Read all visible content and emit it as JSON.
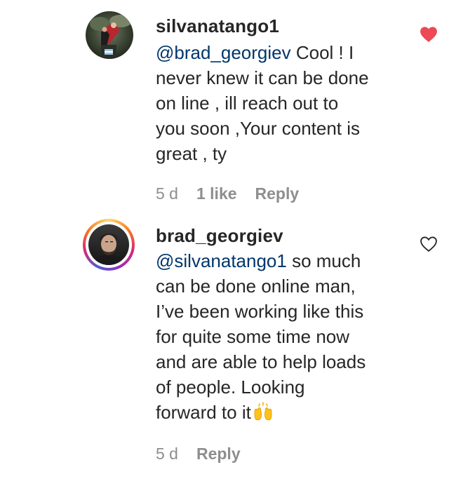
{
  "comments": [
    {
      "username": "silvanatango1",
      "mention": "@brad_georgiev",
      "body_lines": [
        " Cool ! I",
        "never knew it can be done",
        "on line , ill reach out to",
        "you soon ,Your content is",
        "great , ty"
      ],
      "time": "5 d",
      "likes": "1 like",
      "reply_label": "Reply",
      "liked": true,
      "like_color": "#ed4956"
    },
    {
      "username": "brad_georgiev",
      "mention": "@silvanatango1",
      "body_lines": [
        " so much",
        "can be done online man,",
        "I’ve been working like this",
        "for quite some time now",
        "and are able to help loads",
        "of people. Looking",
        "forward to it"
      ],
      "emoji": "raising-hands-emoji",
      "time": "5 d",
      "reply_label": "Reply",
      "liked": false,
      "like_color": "#262626"
    }
  ]
}
